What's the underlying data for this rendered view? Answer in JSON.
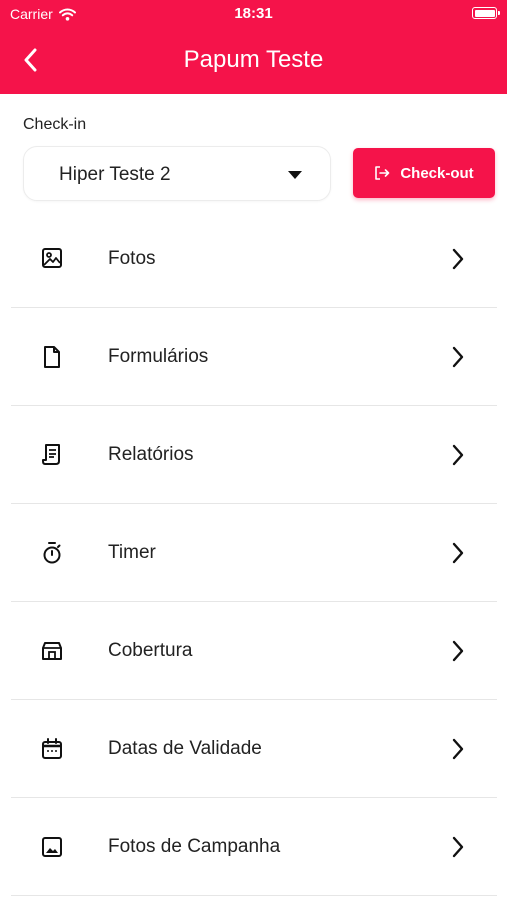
{
  "status_bar": {
    "carrier": "Carrier",
    "time": "18:31",
    "icons": [
      "wifi-icon",
      "battery-icon"
    ]
  },
  "header": {
    "title": "Papum Teste",
    "back_icon": "chevron-left-icon",
    "color": "#f5134a"
  },
  "checkin": {
    "label": "Check-in",
    "selected_store": "Hiper Teste 2",
    "checkout_label": "Check-out",
    "checkout_icon": "logout-icon"
  },
  "menu": [
    {
      "label": "Fotos",
      "icon": "image-icon"
    },
    {
      "label": "Formulários",
      "icon": "file-icon"
    },
    {
      "label": "Relatórios",
      "icon": "receipt-icon"
    },
    {
      "label": "Timer",
      "icon": "stopwatch-icon"
    },
    {
      "label": "Cobertura",
      "icon": "store-icon"
    },
    {
      "label": "Datas de Validade",
      "icon": "calendar-icon"
    },
    {
      "label": "Fotos de Campanha",
      "icon": "photo-icon"
    }
  ]
}
